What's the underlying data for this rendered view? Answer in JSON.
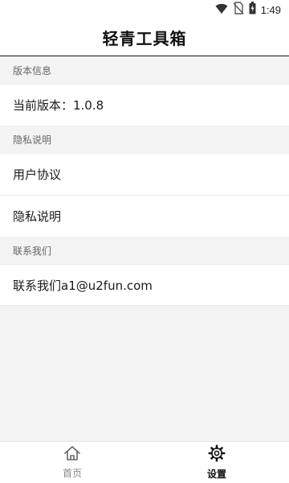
{
  "status_bar": {
    "time": "1:49",
    "icons": [
      "wifi-icon",
      "no-sim-icon",
      "battery-icon"
    ]
  },
  "header": {
    "title": "轻青工具箱"
  },
  "sections": [
    {
      "title": "版本信息",
      "items": [
        "当前版本：1.0.8"
      ]
    },
    {
      "title": "隐私说明",
      "items": [
        "用户协议",
        "隐私说明"
      ]
    },
    {
      "title": "联系我们",
      "items": [
        "联系我们a1@u2fun.com"
      ]
    }
  ],
  "bottom_nav": {
    "items": [
      {
        "label": "首页",
        "icon": "home-icon",
        "active": false
      },
      {
        "label": "设置",
        "icon": "gear-icon",
        "active": true
      }
    ]
  },
  "colors": {
    "background": "#f3f3f3",
    "surface": "#ffffff",
    "text_primary": "#111111",
    "text_secondary": "#666666",
    "nav_inactive": "#888888"
  }
}
